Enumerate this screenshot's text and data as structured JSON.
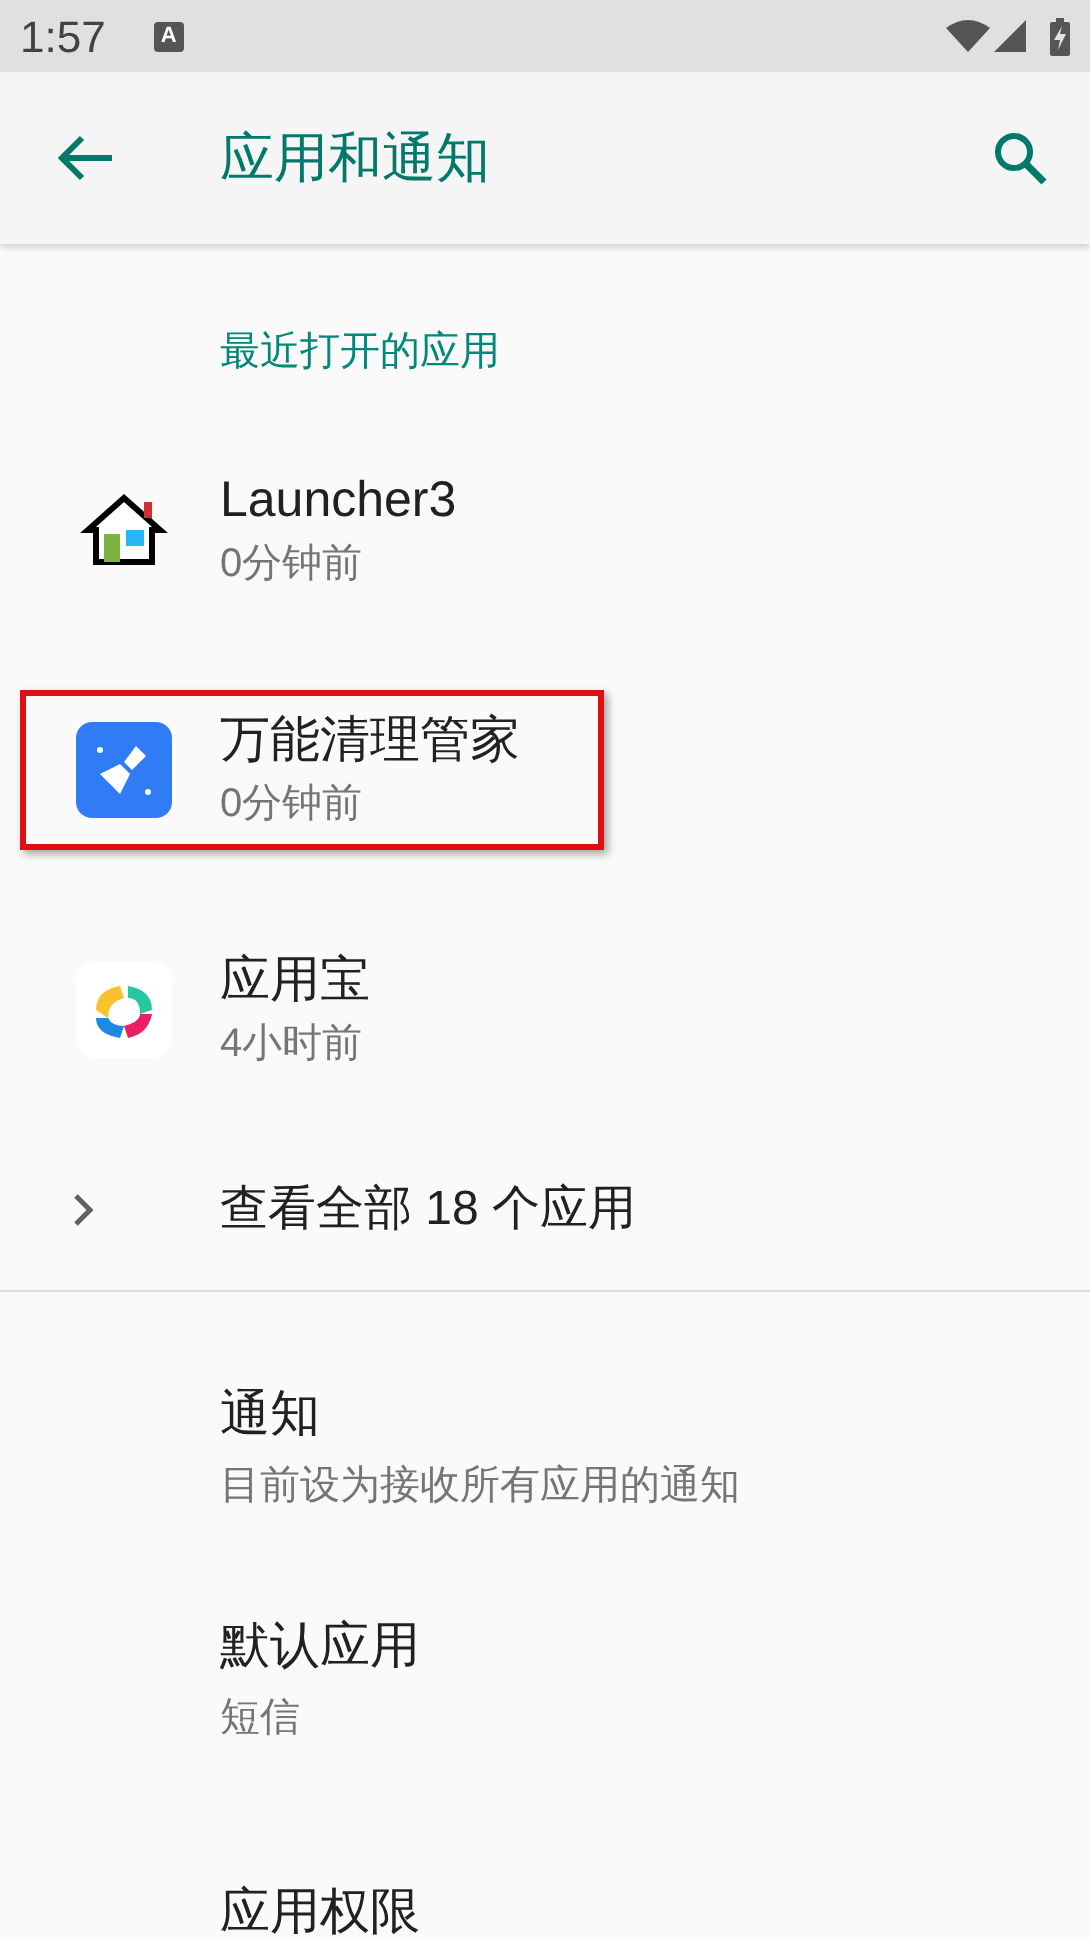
{
  "status_bar": {
    "time": "1:57",
    "notification_icon": "A"
  },
  "app_bar": {
    "title": "应用和通知"
  },
  "recent_apps": {
    "header": "最近打开的应用",
    "apps": [
      {
        "kind": "house",
        "name": "Launcher3",
        "time": "0分钟前",
        "highlighted": false
      },
      {
        "kind": "brush",
        "name": "万能清理管家",
        "time": "0分钟前",
        "highlighted": true
      },
      {
        "kind": "store",
        "name": "应用宝",
        "time": "4小时前",
        "highlighted": false
      }
    ],
    "see_all": "查看全部 18 个应用"
  },
  "settings": [
    {
      "title": "通知",
      "summary": "目前设为接收所有应用的通知"
    },
    {
      "title": "默认应用",
      "summary": "短信"
    },
    {
      "title": "应用权限"
    }
  ]
}
